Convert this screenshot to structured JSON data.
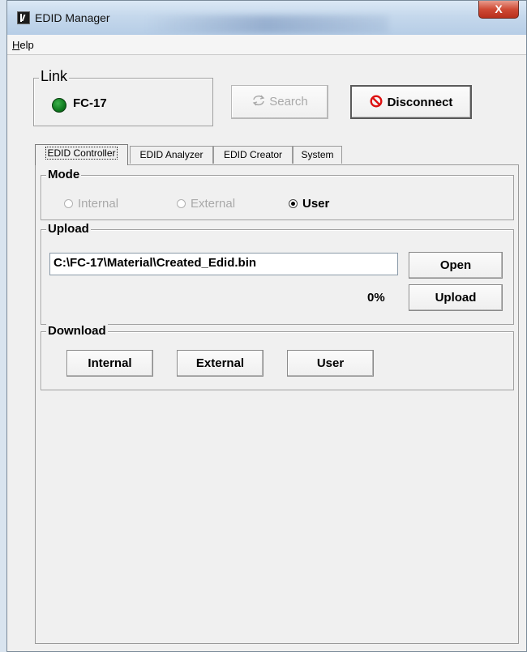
{
  "window": {
    "title": "EDID Manager",
    "close_label": "X"
  },
  "menu": {
    "help_hotkey": "H",
    "help_rest": "elp"
  },
  "link": {
    "legend": "Link",
    "device": "FC-17",
    "status_color": "#0f7a1f"
  },
  "buttons": {
    "search": "Search",
    "disconnect": "Disconnect"
  },
  "tabs": [
    "EDID Controller",
    "EDID Analyzer",
    "EDID Creator",
    "System"
  ],
  "mode": {
    "legend": "Mode",
    "options": [
      "Internal",
      "External",
      "User"
    ],
    "selected": "User"
  },
  "upload": {
    "legend": "Upload",
    "path": "C:\\FC-17\\Material\\Created_Edid.bin",
    "open": "Open",
    "upload": "Upload",
    "progress": "0%"
  },
  "download": {
    "legend": "Download",
    "internal": "Internal",
    "external": "External",
    "user": "User"
  },
  "icons": {
    "app": "kramer-logo-icon",
    "search": "refresh-search-icon",
    "disconnect": "no-entry-icon"
  }
}
